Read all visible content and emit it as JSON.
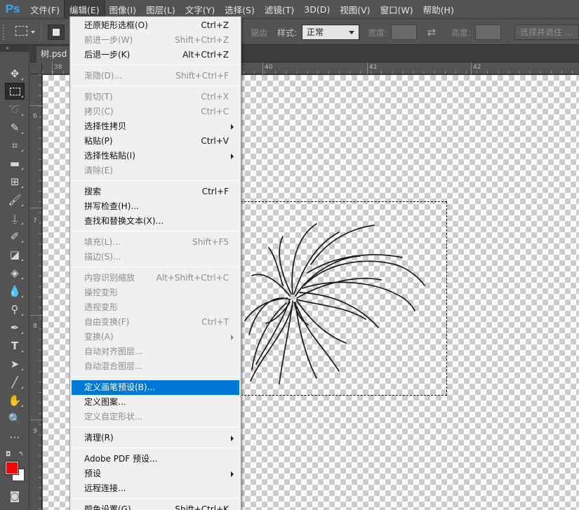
{
  "app": {
    "logo": "Ps"
  },
  "menubar": [
    {
      "label": "文件(F)"
    },
    {
      "label": "编辑(E)"
    },
    {
      "label": "图像(I)"
    },
    {
      "label": "图层(L)"
    },
    {
      "label": "文字(Y)"
    },
    {
      "label": "选择(S)"
    },
    {
      "label": "滤镜(T)"
    },
    {
      "label": "3D(D)"
    },
    {
      "label": "视图(V)"
    },
    {
      "label": "窗口(W)"
    },
    {
      "label": "帮助(H)"
    }
  ],
  "options": {
    "feather_partial": "锯齿",
    "style_label": "样式:",
    "style_value": "正常",
    "width_label": "宽度:",
    "height_label": "高度:",
    "select_mask": "选择并遮住 ..."
  },
  "document": {
    "tab": "树.psd @"
  },
  "ruler": {
    "h": [
      "38",
      "40",
      "41",
      "42"
    ],
    "v": [
      "6",
      "7",
      "8",
      "9"
    ]
  },
  "colors": {
    "foreground": "#ff0000",
    "background": "#ffffff",
    "highlight": "#0078d7"
  },
  "edit_menu": {
    "items": [
      {
        "label": "还原矩形选框(O)",
        "shortcut": "Ctrl+Z"
      },
      {
        "label": "前进一步(W)",
        "shortcut": "Shift+Ctrl+Z"
      },
      {
        "label": "后退一步(K)",
        "shortcut": "Alt+Ctrl+Z"
      },
      {
        "label": "渐隐(D)...",
        "shortcut": "Shift+Ctrl+F"
      },
      {
        "label": "剪切(T)",
        "shortcut": "Ctrl+X"
      },
      {
        "label": "拷贝(C)",
        "shortcut": "Ctrl+C"
      },
      {
        "label": "选择性拷贝",
        "shortcut": ""
      },
      {
        "label": "粘贴(P)",
        "shortcut": "Ctrl+V"
      },
      {
        "label": "选择性粘贴(I)",
        "shortcut": ""
      },
      {
        "label": "清除(E)",
        "shortcut": ""
      },
      {
        "label": "搜索",
        "shortcut": "Ctrl+F"
      },
      {
        "label": "拼写检查(H)...",
        "shortcut": ""
      },
      {
        "label": "查找和替换文本(X)...",
        "shortcut": ""
      },
      {
        "label": "填充(L)...",
        "shortcut": "Shift+F5"
      },
      {
        "label": "描边(S)...",
        "shortcut": ""
      },
      {
        "label": "内容识别缩放",
        "shortcut": "Alt+Shift+Ctrl+C"
      },
      {
        "label": "操控变形",
        "shortcut": ""
      },
      {
        "label": "透视变形",
        "shortcut": ""
      },
      {
        "label": "自由变换(F)",
        "shortcut": "Ctrl+T"
      },
      {
        "label": "变换(A)",
        "shortcut": ""
      },
      {
        "label": "自动对齐图层...",
        "shortcut": ""
      },
      {
        "label": "自动混合图层...",
        "shortcut": ""
      },
      {
        "label": "定义画笔预设(B)...",
        "shortcut": ""
      },
      {
        "label": "定义图案...",
        "shortcut": ""
      },
      {
        "label": "定义自定形状...",
        "shortcut": ""
      },
      {
        "label": "清理(R)",
        "shortcut": ""
      },
      {
        "label": "Adobe PDF 预设...",
        "shortcut": ""
      },
      {
        "label": "预设",
        "shortcut": ""
      },
      {
        "label": "远程连接...",
        "shortcut": ""
      },
      {
        "label": "颜色设置(G)...",
        "shortcut": "Shift+Ctrl+K"
      }
    ]
  }
}
